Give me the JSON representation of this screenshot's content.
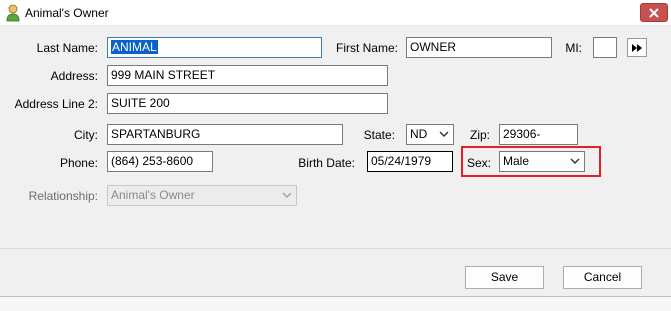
{
  "window": {
    "title": "Animal's Owner",
    "icon": "person-icon"
  },
  "form": {
    "last_name": {
      "label": "Last Name:",
      "value": "ANIMAL"
    },
    "first_name": {
      "label": "First Name:",
      "value": "OWNER"
    },
    "mi": {
      "label": "MI:",
      "value": ""
    },
    "address": {
      "label": "Address:",
      "value": "999 MAIN STREET"
    },
    "address2": {
      "label": "Address Line 2:",
      "value": "SUITE 200"
    },
    "city": {
      "label": "City:",
      "value": "SPARTANBURG"
    },
    "state": {
      "label": "State:",
      "value": "ND"
    },
    "zip": {
      "label": "Zip:",
      "value": "29306-"
    },
    "phone": {
      "label": "Phone:",
      "value": "(864) 253-8600"
    },
    "birth_date": {
      "label": "Birth Date:",
      "value": "05/24/1979"
    },
    "sex": {
      "label": "Sex:",
      "value": "Male"
    },
    "relationship": {
      "label": "Relationship:",
      "value": "Animal's Owner"
    }
  },
  "buttons": {
    "save": "Save",
    "cancel": "Cancel"
  },
  "colors": {
    "highlight": "#e3202a",
    "selection": "#0a62c9",
    "close_button": "#c75050"
  }
}
